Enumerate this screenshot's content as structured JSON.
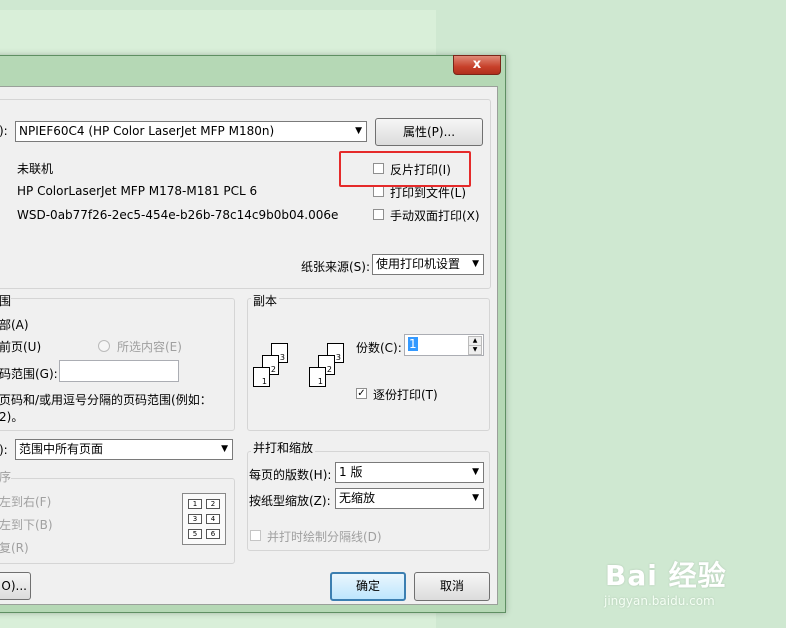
{
  "window": {
    "close_label": "x"
  },
  "printer": {
    "name_label_suffix": "):",
    "selected": "NPIEF60C4 (HP Color LaserJet MFP M180n)",
    "properties_button": "属性(P)...",
    "status": "未联机",
    "type": "HP ColorLaserJet MFP M178-M181 PCL 6",
    "location": "WSD-0ab77f26-2ec5-454e-b26b-78c14c9b0b04.006e",
    "reverse_print": "反片打印(I)",
    "print_to_file": "打印到文件(L)",
    "manual_duplex": "手动双面打印(X)",
    "paper_source_label": "纸张来源(S):",
    "paper_source_value": "使用打印机设置"
  },
  "range": {
    "group_title": "围",
    "all": "部(A)",
    "current_page": "前页(U)",
    "selection": "所选内容(E)",
    "pages_label": "码范围(G):",
    "hint_line1": "页码和/或用逗号分隔的页码范围(例如：",
    "hint_line2": "2)。"
  },
  "copies": {
    "group_title": "副本",
    "count_label": "份数(C):",
    "count_value": "1",
    "collate": "逐份打印(T)",
    "page_numbers": [
      "3",
      "2",
      "1"
    ]
  },
  "print_what": {
    "label_suffix": "):",
    "value": "范围中所有页面"
  },
  "order": {
    "group_title": "序",
    "left_to_right": "左到右(F)",
    "top_to_bottom": "左到下(B)",
    "repeat": "复(R)",
    "grid": [
      "1",
      "2",
      "3",
      "4",
      "5",
      "6"
    ]
  },
  "zoom": {
    "group_title": "并打和缩放",
    "pages_per_sheet_label": "每页的版数(H):",
    "pages_per_sheet_value": "1 版",
    "scale_label": "按纸型缩放(Z):",
    "scale_value": "无缩放",
    "draw_borders": "并打时绘制分隔线(D)"
  },
  "footer": {
    "options_button": "O)...",
    "ok_button": "确定",
    "cancel_button": "取消"
  },
  "watermark": {
    "brand": "Bai 经验",
    "url": "jingyan.baidu.com"
  },
  "colors": {
    "desktop": "#cfe8d1",
    "accent_red": "#e52a2a",
    "default_button": "#3c7fb1"
  }
}
